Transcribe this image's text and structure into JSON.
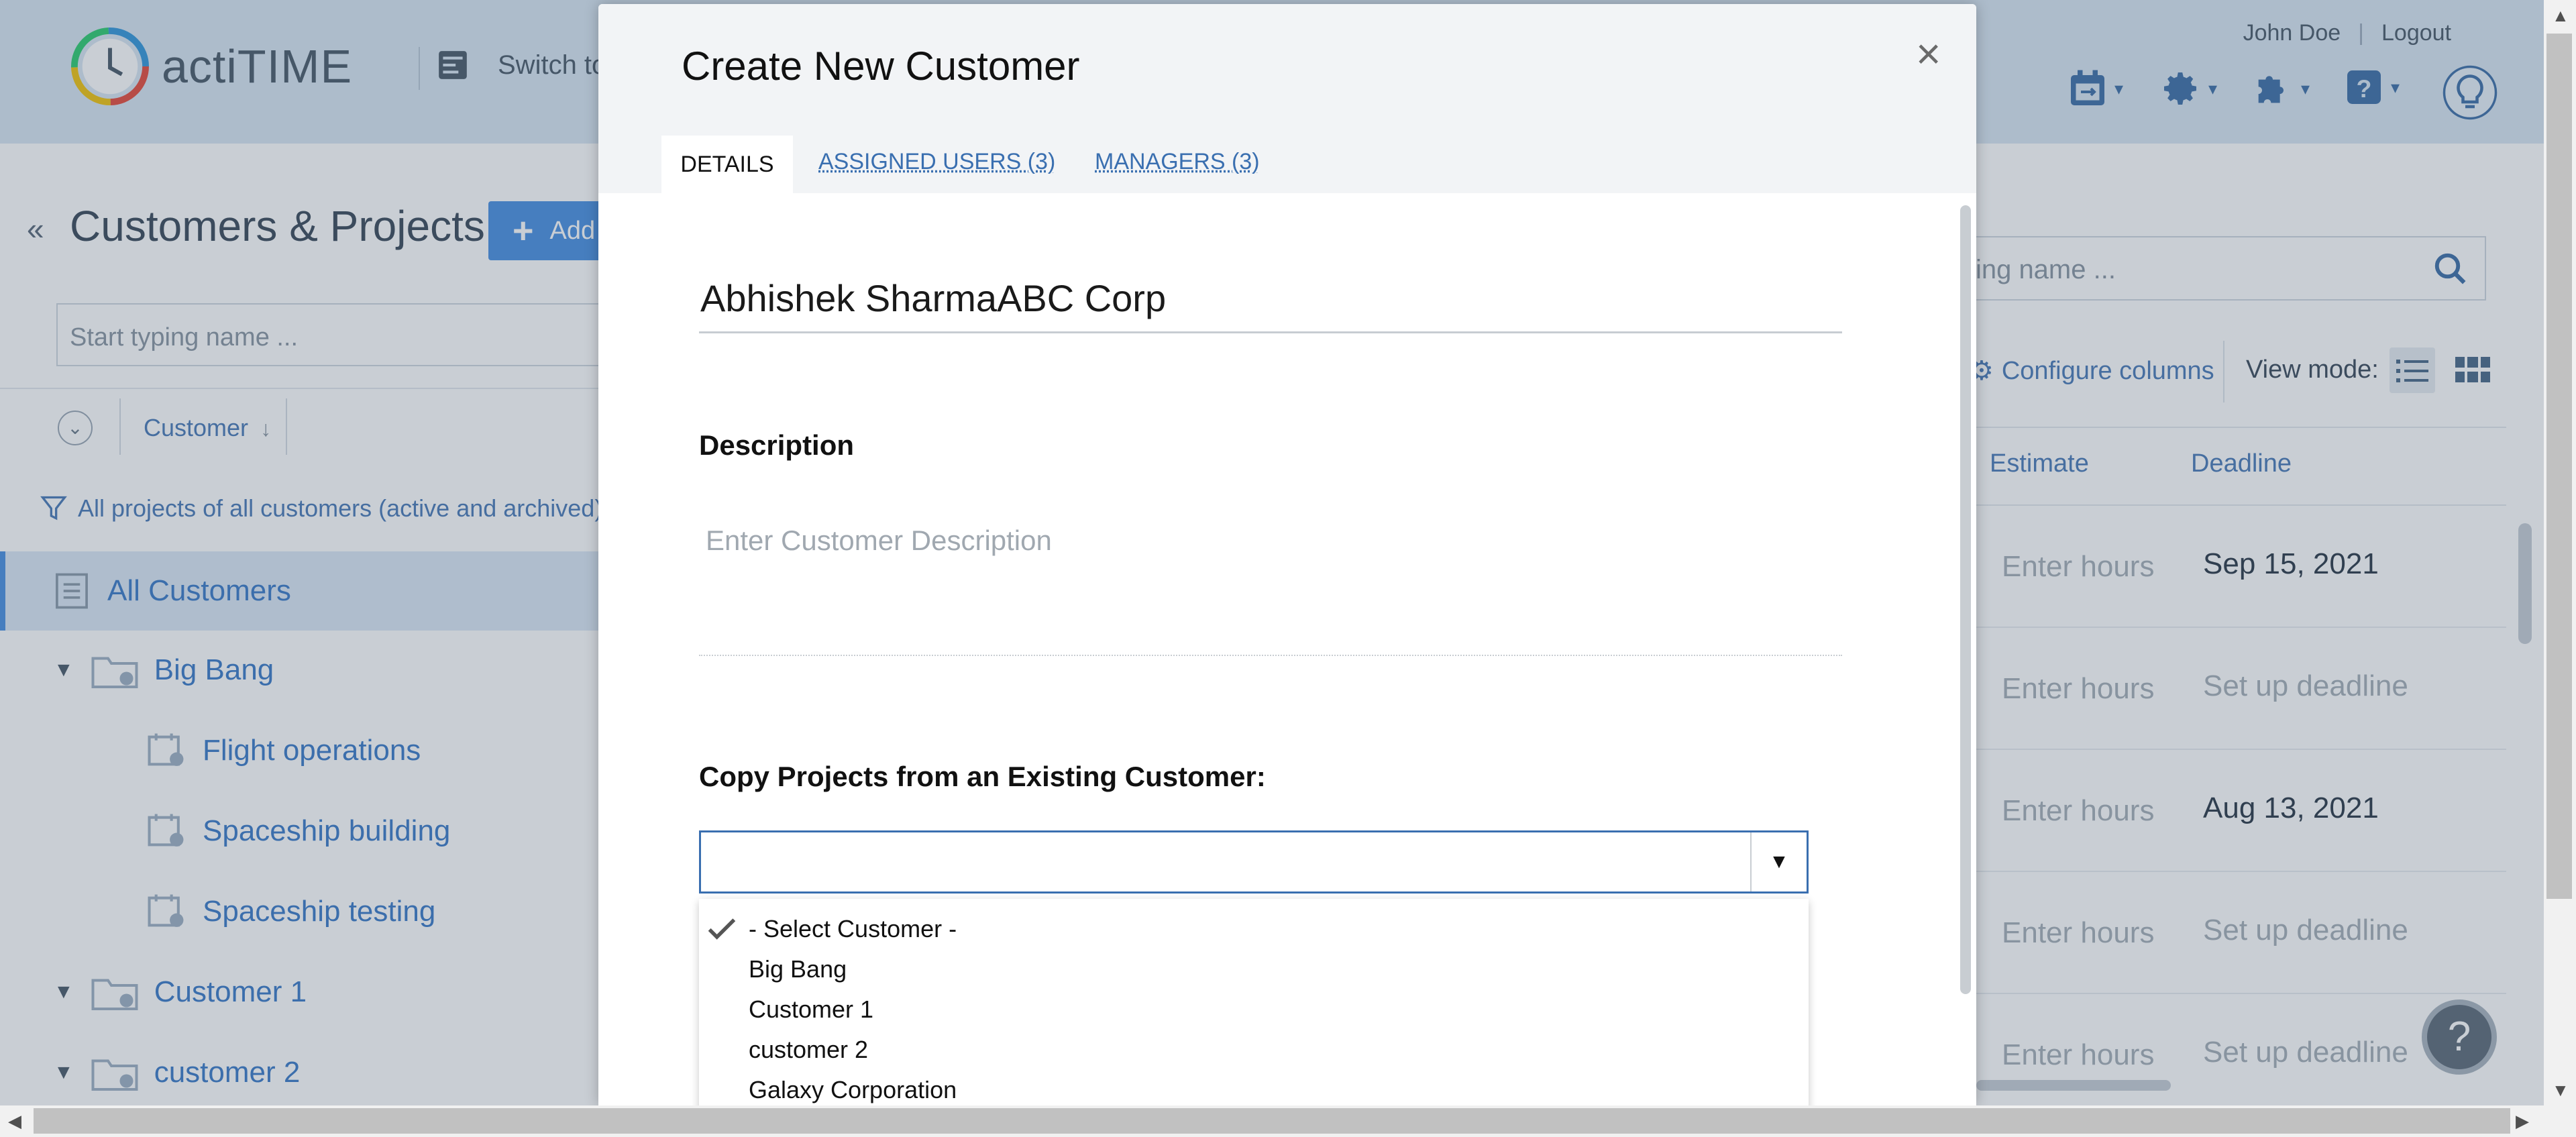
{
  "app": {
    "brand": "actiTIME",
    "switch_label": "Switch to",
    "user_name": "John Doe",
    "logout_label": "Logout"
  },
  "left": {
    "page_title": "Customers & Projects",
    "add_label": "Add",
    "search_placeholder": "Start typing name ...",
    "column_customer": "Customer",
    "filter_text": "All projects of all customers (active and archived)",
    "tree": [
      {
        "label": "All Customers",
        "kind": "all"
      },
      {
        "label": "Big Bang",
        "kind": "customer"
      },
      {
        "label": "Flight operations",
        "kind": "project"
      },
      {
        "label": "Spaceship building",
        "kind": "project"
      },
      {
        "label": "Spaceship testing",
        "kind": "project"
      },
      {
        "label": "Customer 1",
        "kind": "customer"
      },
      {
        "label": "customer 2",
        "kind": "customer"
      }
    ]
  },
  "right": {
    "search_placeholder": "Start typing name ...",
    "configure_label": "Configure columns",
    "view_mode_label": "View mode:",
    "col_estimate": "Estimate",
    "col_deadline": "Deadline",
    "rows": [
      {
        "estimate": "Enter hours",
        "deadline": "Sep 15, 2021"
      },
      {
        "estimate": "Enter hours",
        "deadline": "Set up deadline"
      },
      {
        "estimate": "Enter hours",
        "deadline": "Aug 13, 2021"
      },
      {
        "estimate": "Enter hours",
        "deadline": "Set up deadline"
      },
      {
        "estimate": "Enter hours",
        "deadline": "Set up deadline"
      }
    ],
    "help_label": "?"
  },
  "modal": {
    "title": "Create New Customer",
    "close_label": "×",
    "tabs": [
      {
        "label": "DETAILS"
      },
      {
        "label": "ASSIGNED USERS (3)"
      },
      {
        "label": "MANAGERS (3)"
      }
    ],
    "name_value": "Abhishek SharmaABC Corp",
    "description_label": "Description",
    "description_placeholder": "Enter Customer Description",
    "copy_label": "Copy Projects from an Existing Customer:",
    "copy_value": "",
    "dropdown_options": [
      "- Select Customer -",
      "Big Bang",
      "Customer 1",
      "customer 2",
      "Galaxy Corporation"
    ]
  },
  "colors": {
    "accent": "#4a90e2",
    "link": "#3a6fb0",
    "header_bg": "#d9e7f3"
  }
}
